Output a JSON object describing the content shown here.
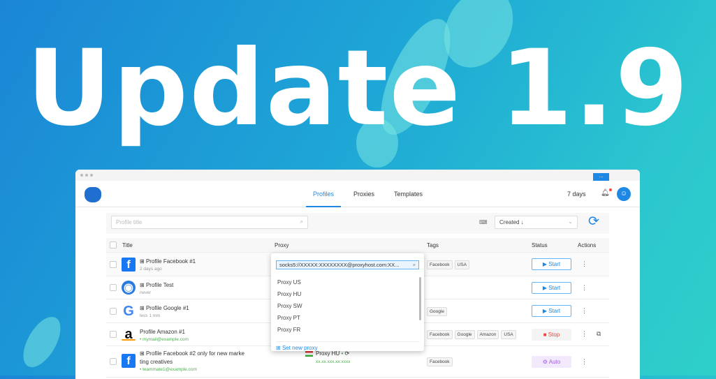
{
  "headline": "Update 1.9",
  "titlebar": {
    "button": "..."
  },
  "nav": {
    "tabs": [
      "Profiles",
      "Proxies",
      "Templates"
    ],
    "active": 0,
    "days": "7 days"
  },
  "toolbar": {
    "search_placeholder": "Profile title",
    "sort": "Created ↓"
  },
  "table": {
    "headers": [
      "Title",
      "Proxy",
      "Tags",
      "Status",
      "Actions"
    ],
    "rows": [
      {
        "name": "Profile Facebook #1",
        "sub": "2 days ago",
        "tags": [
          "Facebook",
          "USA"
        ],
        "status": "Start"
      },
      {
        "name": "Profile Test",
        "sub": "never",
        "tags": [],
        "status": "Start"
      },
      {
        "name": "Profile Google #1",
        "sub": "less 1 min",
        "tags": [
          "Google"
        ],
        "status": "Start"
      },
      {
        "name": "Profile Amazon #1",
        "sub": "mymail@example.com",
        "tags": [
          "Facebook",
          "Google",
          "Amazon",
          "USA"
        ],
        "status": "Stop"
      },
      {
        "name": "Profile Facebook #2 only for new marke",
        "name2": "ting creatives",
        "sub": "teammate1@example.com",
        "tags": [
          "Facebook"
        ],
        "status": "Auto",
        "proxy": "Proxy HU",
        "ip": "xx.xx.xxx.xx:xxxx"
      }
    ]
  },
  "dropdown": {
    "value": "socks5://XXXXX:XXXXXXXX@proxyhost.com:XX...",
    "options": [
      "Proxy US",
      "Proxy HU",
      "Proxy SW",
      "Proxy PT",
      "Proxy FR"
    ],
    "add": "Set new proxy"
  }
}
